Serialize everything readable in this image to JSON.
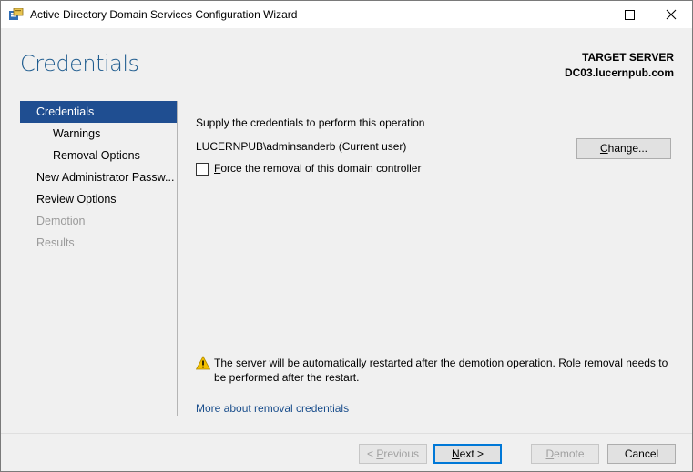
{
  "window": {
    "title": "Active Directory Domain Services Configuration Wizard",
    "icons": {
      "app": "server-wizard-icon",
      "minimize": "minimize-icon",
      "maximize": "maximize-icon",
      "close": "close-icon"
    }
  },
  "header": {
    "page_title": "Credentials",
    "target_label": "TARGET SERVER",
    "target_name": "DC03.lucernpub.com"
  },
  "nav": {
    "items": [
      {
        "label": "Credentials",
        "state": "active"
      },
      {
        "label": "Warnings",
        "state": "normal"
      },
      {
        "label": "Removal Options",
        "state": "normal"
      },
      {
        "label": "New Administrator Passw...",
        "state": "normal"
      },
      {
        "label": "Review Options",
        "state": "normal"
      },
      {
        "label": "Demotion",
        "state": "disabled"
      },
      {
        "label": "Results",
        "state": "disabled"
      }
    ]
  },
  "main": {
    "supply_text": "Supply the credentials to perform this operation",
    "current_user": "LUCERNPUB\\adminsanderb (Current user)",
    "change_button": {
      "prefix": "",
      "mnemonic": "C",
      "rest": "hange..."
    },
    "force_removal": {
      "checked": false,
      "mnemonic": "F",
      "rest": "orce the removal of this domain controller"
    },
    "warning_text": "The server will be automatically restarted after the demotion operation. Role removal needs to be performed after the restart.",
    "more_link": "More about removal credentials"
  },
  "footer": {
    "previous": {
      "prefix": "< ",
      "mnemonic": "P",
      "rest": "revious",
      "enabled": false
    },
    "next": {
      "prefix": "",
      "mnemonic": "N",
      "rest": "ext >",
      "enabled": true
    },
    "demote": {
      "prefix": "",
      "mnemonic": "D",
      "rest": "emote",
      "enabled": false
    },
    "cancel": {
      "label": "Cancel",
      "enabled": true
    }
  },
  "colors": {
    "accent": "#1f4e91",
    "title": "#1f5c8f",
    "link": "#1a4e8c",
    "warning": "#f3c000"
  }
}
